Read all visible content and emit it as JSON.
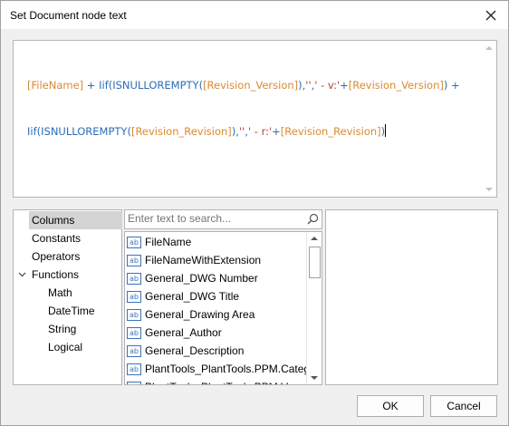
{
  "window": {
    "title": "Set Document node text",
    "close_icon": "close-icon"
  },
  "expression": {
    "line1": [
      {
        "t": "[FileName]",
        "k": "field"
      },
      {
        "t": " + ",
        "k": "op"
      },
      {
        "t": "Iif(",
        "k": "fn"
      },
      {
        "t": "ISNULLOREMPTY(",
        "k": "fn"
      },
      {
        "t": "[Revision_Version]",
        "k": "field"
      },
      {
        "t": "),",
        "k": "op"
      },
      {
        "t": "''",
        "k": "str"
      },
      {
        "t": ",",
        "k": "op"
      },
      {
        "t": "' - v:'",
        "k": "str"
      },
      {
        "t": "+",
        "k": "op"
      },
      {
        "t": "[Revision_Version]",
        "k": "field"
      },
      {
        "t": ") +",
        "k": "op"
      }
    ],
    "line2": [
      {
        "t": "Iif(",
        "k": "fn"
      },
      {
        "t": "ISNULLOREMPTY(",
        "k": "fn"
      },
      {
        "t": "[Revision_Revision]",
        "k": "field"
      },
      {
        "t": "),",
        "k": "op"
      },
      {
        "t": "''",
        "k": "str"
      },
      {
        "t": ",",
        "k": "op"
      },
      {
        "t": "' - r:'",
        "k": "str"
      },
      {
        "t": "+",
        "k": "op"
      },
      {
        "t": "[Revision_Revision]",
        "k": "field"
      },
      {
        "t": ")",
        "k": "op"
      }
    ]
  },
  "categories": [
    {
      "label": "Columns",
      "selected": true,
      "indent": 0
    },
    {
      "label": "Constants",
      "selected": false,
      "indent": 0
    },
    {
      "label": "Operators",
      "selected": false,
      "indent": 0
    },
    {
      "label": "Functions",
      "selected": false,
      "indent": 0,
      "expanded": true
    },
    {
      "label": "Math",
      "selected": false,
      "indent": 1
    },
    {
      "label": "DateTime",
      "selected": false,
      "indent": 1
    },
    {
      "label": "String",
      "selected": false,
      "indent": 1
    },
    {
      "label": "Logical",
      "selected": false,
      "indent": 1
    }
  ],
  "search": {
    "placeholder": "Enter text to search..."
  },
  "columns": [
    "FileName",
    "FileNameWithExtension",
    "General_DWG Number",
    "General_DWG Title",
    "General_Drawing Area",
    "General_Author",
    "General_Description",
    "PlantTools_PlantTools.PPM.Categ...",
    "PlantTools_PlantTools.PPM.Vers..."
  ],
  "column_icon_text": "ab",
  "buttons": {
    "ok": "OK",
    "cancel": "Cancel"
  },
  "colors": {
    "field": "#d98a32",
    "function": "#2d6cb5",
    "string": "#b04040",
    "selection": "#d4d4d4"
  }
}
